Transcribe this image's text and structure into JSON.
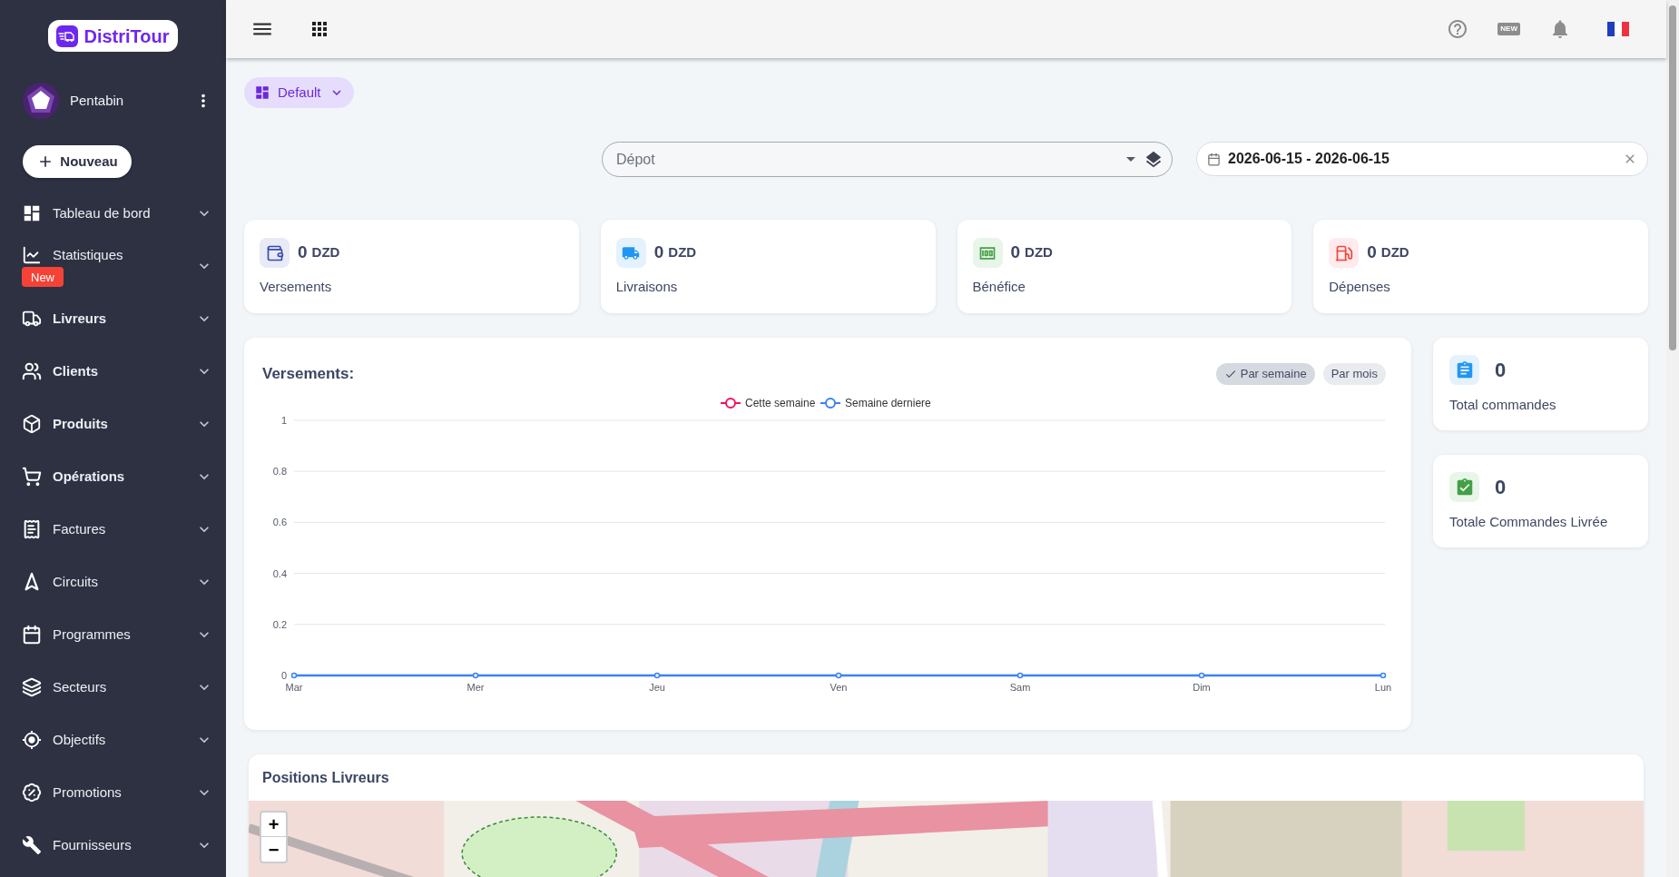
{
  "sidebar": {
    "logo": "DistriTour",
    "user": {
      "name": "Pentabin"
    },
    "new_button": "Nouveau",
    "items": [
      {
        "label": "Tableau de bord",
        "emphasized": false
      },
      {
        "label": "Statistiques",
        "emphasized": false,
        "badge": "New"
      },
      {
        "label": "Livreurs",
        "emphasized": true
      },
      {
        "label": "Clients",
        "emphasized": true
      },
      {
        "label": "Produits",
        "emphasized": true
      },
      {
        "label": "Opérations",
        "emphasized": true
      },
      {
        "label": "Factures",
        "emphasized": false
      },
      {
        "label": "Circuits",
        "emphasized": false
      },
      {
        "label": "Programmes",
        "emphasized": false
      },
      {
        "label": "Secteurs",
        "emphasized": false
      },
      {
        "label": "Objectifs",
        "emphasized": false
      },
      {
        "label": "Promotions",
        "emphasized": false
      },
      {
        "label": "Fournisseurs",
        "emphasized": false
      }
    ]
  },
  "top_bar": {
    "whats_new": "NEW"
  },
  "layout_selector": {
    "label": "Default"
  },
  "filters": {
    "depot_select": {
      "placeholder": "Dépot"
    },
    "date_range": {
      "value": "2026-06-15 - 2026-06-15"
    }
  },
  "stat_cards": [
    {
      "value": "0",
      "unit": "DZD",
      "label": "Versements"
    },
    {
      "value": "0",
      "unit": "DZD",
      "label": "Livraisons"
    },
    {
      "value": "0",
      "unit": "DZD",
      "label": "Bénéfice"
    },
    {
      "value": "0",
      "unit": "DZD",
      "label": "Dépenses"
    }
  ],
  "chart_panel": {
    "title": "Versements:",
    "toggles": [
      {
        "label": "Par semaine",
        "selected": true
      },
      {
        "label": "Par mois",
        "selected": false
      }
    ],
    "chart_data": {
      "type": "line",
      "categories": [
        "Mar",
        "Mer",
        "Jeu",
        "Ven",
        "Sam",
        "Dim",
        "Lun"
      ],
      "series": [
        {
          "name": "Cette semaine",
          "color": "#f5115a",
          "values": [
            null,
            null,
            null,
            null,
            null,
            null,
            null
          ]
        },
        {
          "name": "Semaine derniere",
          "color": "#3b82f6",
          "marker": "circle",
          "values": [
            0,
            0,
            0,
            0,
            0,
            0,
            0
          ]
        }
      ],
      "ylim": [
        0,
        1
      ],
      "yticks": [
        0,
        0.2,
        0.4,
        0.6,
        0.8,
        1
      ],
      "grid": true,
      "legend": "top"
    }
  },
  "order_cards": [
    {
      "value": "0",
      "label": "Total commandes"
    },
    {
      "value": "0",
      "label": "Totale Commandes Livrée"
    }
  ],
  "map_panel": {
    "title": "Positions Livreurs",
    "zoom_in": "+",
    "zoom_out": "−"
  }
}
